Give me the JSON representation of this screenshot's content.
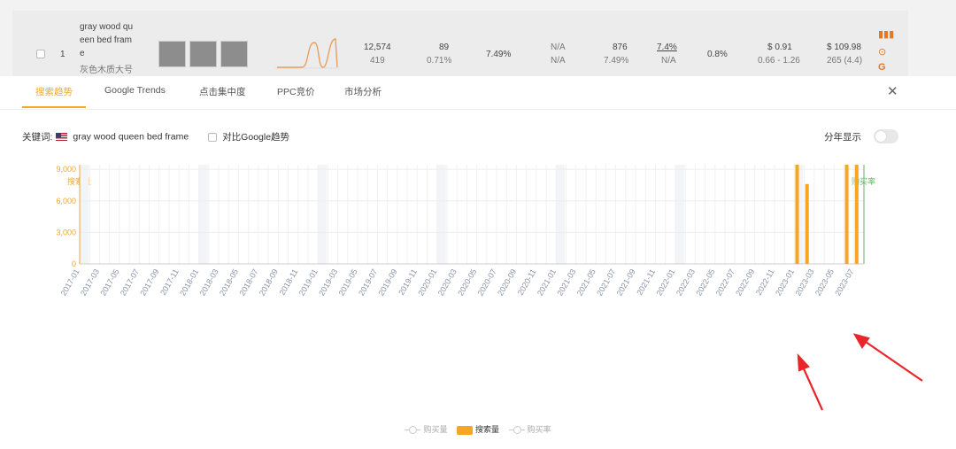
{
  "row": {
    "index": "1",
    "title_lines": [
      "gray wood qu",
      "een bed fram",
      "e"
    ],
    "title_cn": "灰色木质大号",
    "search_volume": "12,574",
    "search_rank": "419",
    "clicks": "89",
    "click_rate": "0.71%",
    "rate": "7.49%",
    "na1": "N/A",
    "na2": "N/A",
    "products": "876",
    "products_pct": "7.49%",
    "share": "7.4%",
    "share_sub": "N/A",
    "conv": "0.8%",
    "ppc": "$ 0.91",
    "ppc_range": "0.66 - 1.26",
    "price": "$ 109.98",
    "price_sub": "265 (4.4)"
  },
  "tabs": [
    {
      "label": "搜索趋势",
      "active": true
    },
    {
      "label": "Google Trends"
    },
    {
      "label": "点击集中度"
    },
    {
      "label": "PPC竞价"
    },
    {
      "label": "市场分析"
    }
  ],
  "close_label": "✕",
  "keyword_label": "关键词:",
  "keyword": "gray wood queen bed frame",
  "compare_label": "对比Google趋势",
  "by_year_label": "分年显示",
  "colors": {
    "accent": "#f5a623",
    "conversion": "#5cb85c"
  },
  "chart_data": {
    "type": "bar",
    "y_left_title": "搜索量",
    "y_right_title": "购买率",
    "ylim": [
      0,
      15000
    ],
    "yticks": [
      "0",
      "3,000",
      "6,000",
      "9,000",
      "12,000",
      "15,000"
    ],
    "x_start": "2017-01",
    "months": 80,
    "series": [
      {
        "name": "搜索量",
        "points": [
          {
            "x": "2023-01",
            "y": 9900
          },
          {
            "x": "2023-02",
            "y": 7600
          },
          {
            "x": "2023-06",
            "y": 11700
          },
          {
            "x": "2023-07",
            "y": 12574
          }
        ]
      }
    ],
    "legend": [
      "购买量",
      "搜索量",
      "购买率"
    ]
  }
}
